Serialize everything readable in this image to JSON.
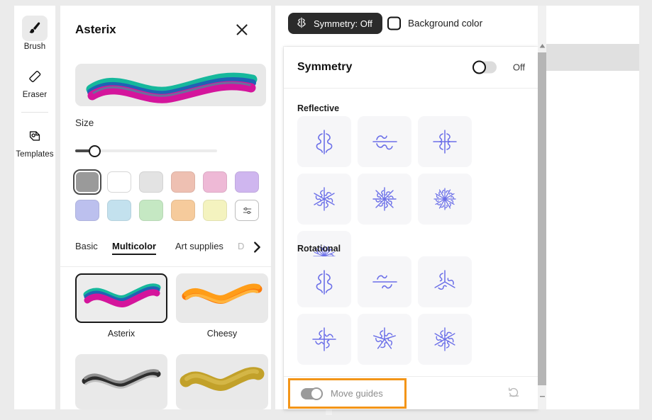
{
  "toolrail": {
    "items": [
      {
        "label": "Brush",
        "icon": "brush-icon",
        "active": true
      },
      {
        "label": "Eraser",
        "icon": "eraser-icon",
        "active": false
      },
      {
        "label": "Templates",
        "icon": "templates-icon",
        "active": false
      }
    ]
  },
  "brush_panel": {
    "title": "Asterix",
    "close_icon": "close-icon",
    "preview_name": "brush-preview-stroke",
    "size_label": "Size",
    "size_value": "49",
    "slider_percent": 13,
    "color_swatches": [
      {
        "name": "gray",
        "hex": "#9a9a9a",
        "selected": true
      },
      {
        "name": "white",
        "hex": "#ffffff",
        "selected": false
      },
      {
        "name": "light-gray",
        "hex": "#e3e3e3",
        "selected": false
      },
      {
        "name": "salmon",
        "hex": "#eec0b2",
        "selected": false
      },
      {
        "name": "pink",
        "hex": "#eeb9d6",
        "selected": false
      },
      {
        "name": "lavender",
        "hex": "#cfb6ef",
        "selected": false
      },
      {
        "name": "periwinkle",
        "hex": "#bcc0ee",
        "selected": false
      },
      {
        "name": "light-blue",
        "hex": "#c3e1ee",
        "selected": false
      },
      {
        "name": "mint",
        "hex": "#c5e8c3",
        "selected": false
      },
      {
        "name": "peach",
        "hex": "#f6cb9c",
        "selected": false
      },
      {
        "name": "cream",
        "hex": "#f4f3bf",
        "selected": false
      },
      {
        "name": "color-settings",
        "hex": "#ffffff",
        "selected": false,
        "is_settings": true
      }
    ],
    "tabs": [
      {
        "label": "Basic",
        "active": false
      },
      {
        "label": "Multicolor",
        "active": true
      },
      {
        "label": "Art supplies",
        "active": false
      },
      {
        "label": "D",
        "active": false,
        "faded": true
      }
    ],
    "next_tab_icon": "chevron-right-icon",
    "gallery": [
      {
        "name": "Asterix",
        "selected": true,
        "colors": [
          "#16b89c",
          "#1f63b4",
          "#d4159c"
        ]
      },
      {
        "name": "Cheesy",
        "selected": false,
        "colors": [
          "#ff9d18",
          "#fb7a0b",
          "#ffb43d"
        ]
      },
      {
        "name": "",
        "selected": false,
        "colors": [
          "#4a4a4a",
          "#1c1c1c",
          "#9e9e9e"
        ]
      },
      {
        "name": "",
        "selected": false,
        "colors": [
          "#c9a528",
          "#b08f1c",
          "#d8bb4e"
        ]
      }
    ]
  },
  "toolbar": {
    "symmetry_button_label": "Symmetry: Off",
    "symmetry_icon": "symmetry-icon",
    "background_color_label": "Background color",
    "background_color_swatch": "#ffffff"
  },
  "symmetry_panel": {
    "title": "Symmetry",
    "toggle_state_label": "Off",
    "toggle_on": false,
    "sections": [
      {
        "title": "Reflective",
        "options": [
          {
            "name": "reflective-vertical",
            "type": "mirror-v"
          },
          {
            "name": "reflective-horizontal",
            "type": "mirror-h"
          },
          {
            "name": "reflective-quad",
            "type": "quad"
          },
          {
            "name": "reflective-6-way",
            "type": "star6"
          },
          {
            "name": "reflective-8-way",
            "type": "star8"
          },
          {
            "name": "reflective-12-way",
            "type": "star12"
          },
          {
            "name": "reflective-16-way",
            "type": "star16"
          }
        ]
      },
      {
        "title": "Rotational",
        "options": [
          {
            "name": "rotational-2-way",
            "type": "rot-v"
          },
          {
            "name": "rotational-horizontal",
            "type": "rot-h"
          },
          {
            "name": "rotational-3-way",
            "type": "rot3"
          },
          {
            "name": "rotational-4-way",
            "type": "rot4"
          },
          {
            "name": "rotational-5-way",
            "type": "rot5"
          },
          {
            "name": "rotational-6-way",
            "type": "rot6"
          }
        ]
      }
    ],
    "footer": {
      "move_guides_label": "Move guides",
      "move_guides_on": true,
      "reset_icon": "reset-icon",
      "highlight_color": "#f39518"
    }
  },
  "scrollbars": {
    "up_arrow": "▲",
    "down_arrow": "▬"
  },
  "icon_color": "#6b6fe8"
}
